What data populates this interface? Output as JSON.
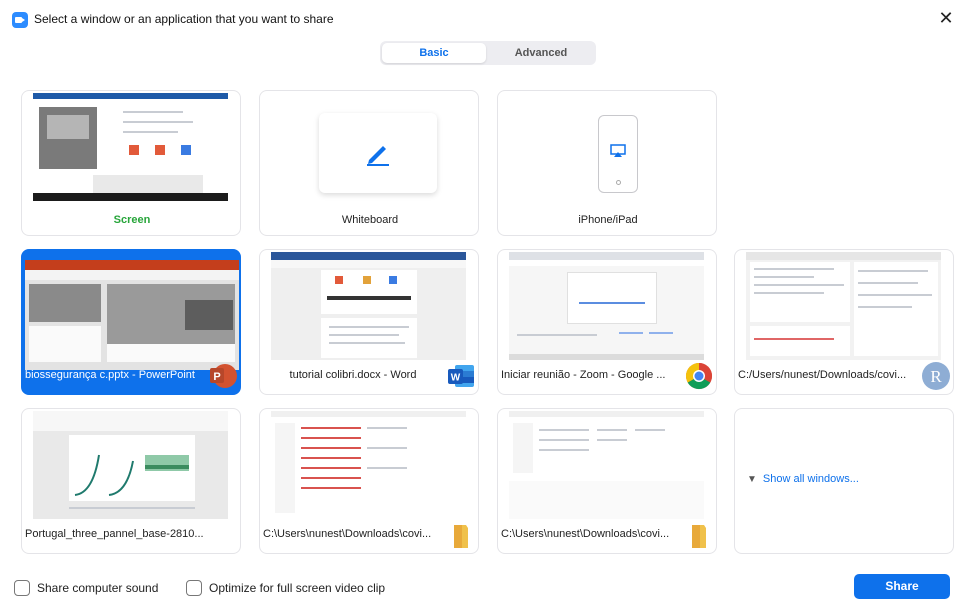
{
  "dialog": {
    "title": "Select a window or an application that you want to share"
  },
  "tabs": [
    {
      "label": "Basic",
      "active": true
    },
    {
      "label": "Advanced",
      "active": false
    }
  ],
  "tiles": [
    {
      "label": "Screen",
      "type": "screen"
    },
    {
      "label": "Whiteboard",
      "type": "whiteboard"
    },
    {
      "label": "iPhone/iPad",
      "type": "device"
    },
    {
      "label": "biossegurança c.pptx - PowerPoint",
      "app_icon": "powerpoint-icon",
      "selected": true
    },
    {
      "label": "tutorial colibri.docx - Word",
      "app_icon": "word-icon"
    },
    {
      "label": "Iniciar reunião - Zoom - Google ...",
      "app_icon": "chrome-icon"
    },
    {
      "label": "C:/Users/nunest/Downloads/covi...",
      "app_icon": "r-icon"
    },
    {
      "label": "Portugal_three_pannel_base-2810..."
    },
    {
      "label": "C:\\Users\\nunest\\Downloads\\covi...",
      "app_icon": "folder-icon"
    },
    {
      "label": "C:\\Users\\nunest\\Downloads\\covi...",
      "app_icon": "folder-icon"
    }
  ],
  "show_all": {
    "label": "Show all windows..."
  },
  "footer": {
    "share_sound": "Share computer sound",
    "optimize_video": "Optimize for full screen video clip",
    "share_button": "Share"
  },
  "colors": {
    "accent": "#0e71eb",
    "screen_label": "#27a53a"
  }
}
